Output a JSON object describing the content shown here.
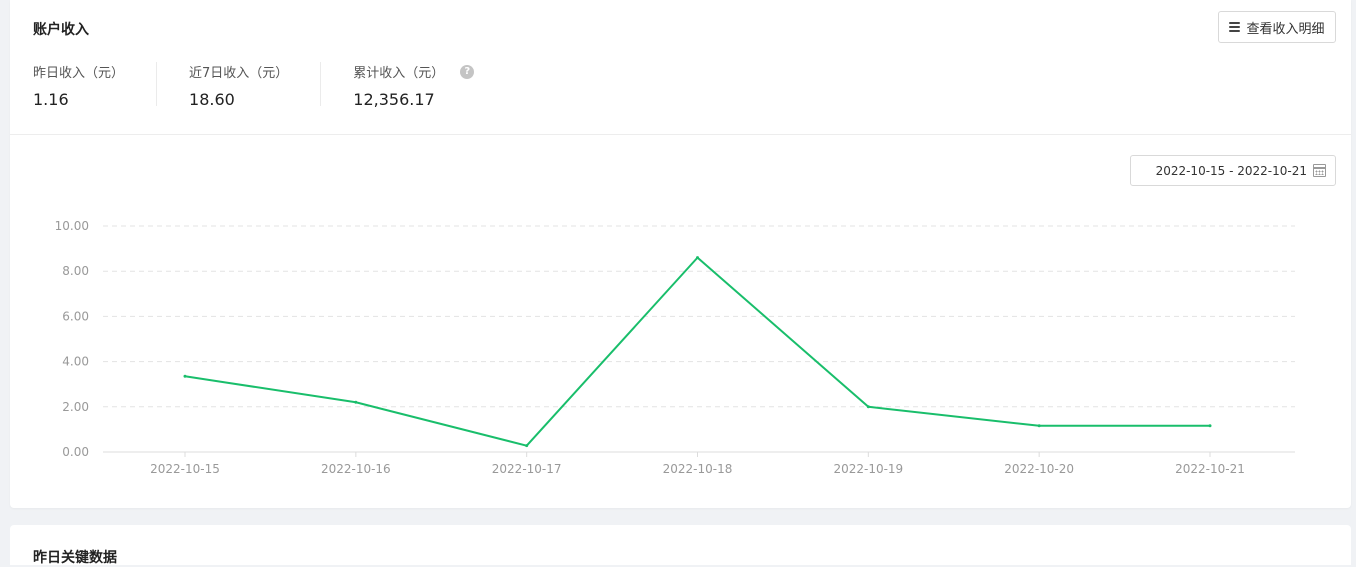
{
  "income_card": {
    "title": "账户收入",
    "detail_button_label": "查看收入明细",
    "stats": [
      {
        "label": "昨日收入（元）",
        "value": "1.16"
      },
      {
        "label": "近7日收入（元）",
        "value": "18.60"
      },
      {
        "label": "累计收入（元）",
        "value": "12,356.17"
      }
    ],
    "help_glyph": "?",
    "date_range": "2022-10-15 - 2022-10-21"
  },
  "second_card": {
    "title": "昨日关键数据"
  },
  "chart_data": {
    "type": "line",
    "x": [
      "2022-10-15",
      "2022-10-16",
      "2022-10-17",
      "2022-10-18",
      "2022-10-19",
      "2022-10-20",
      "2022-10-21"
    ],
    "series": [
      {
        "values": [
          3.35,
          2.2,
          0.28,
          8.6,
          2.0,
          1.16,
          1.16
        ],
        "color": "#19be6b"
      }
    ],
    "yticks": [
      "0.00",
      "2.00",
      "4.00",
      "6.00",
      "8.00",
      "10.00"
    ],
    "ylim": [
      0,
      10
    ],
    "grid": true,
    "grid_style": "dashed-horizontal"
  }
}
